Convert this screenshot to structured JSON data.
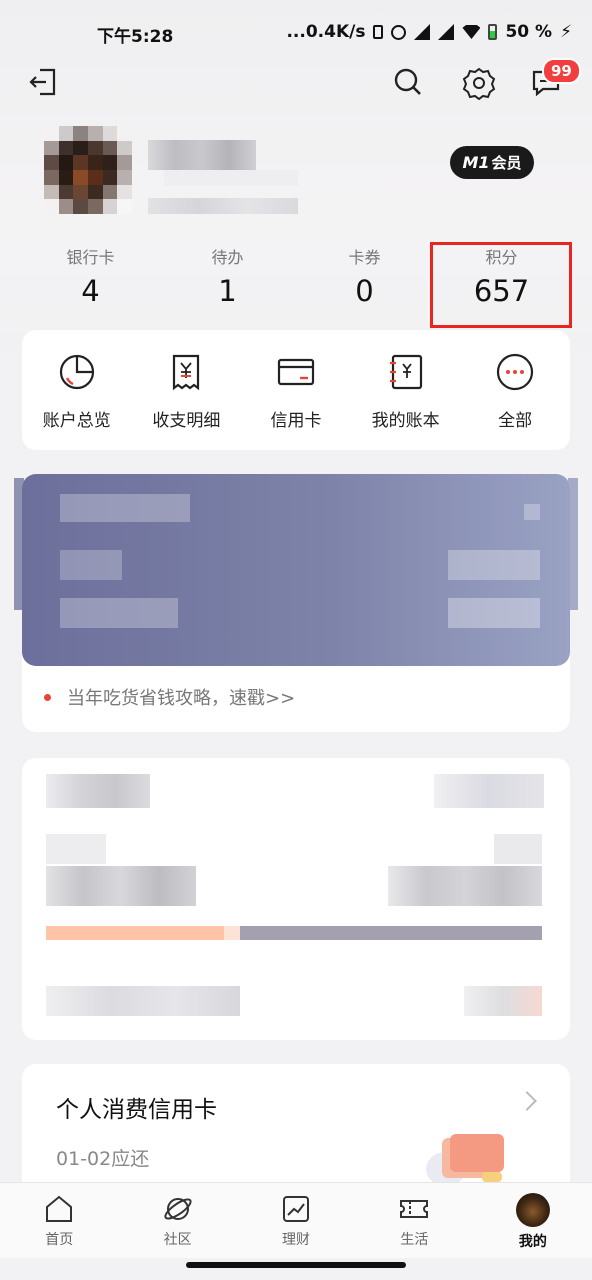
{
  "status_bar": {
    "time": "下午5:28",
    "net_speed": "...0.4K/s",
    "battery": "50 %"
  },
  "header": {
    "messages_badge": "99"
  },
  "profile": {
    "member_label": "会员",
    "member_brand": "M1"
  },
  "stats": [
    {
      "label": "银行卡",
      "value": "4"
    },
    {
      "label": "待办",
      "value": "1"
    },
    {
      "label": "卡券",
      "value": "0"
    },
    {
      "label": "积分",
      "value": "657"
    }
  ],
  "quick_menu": [
    {
      "label": "账户总览",
      "icon": "pie-chart-icon"
    },
    {
      "label": "收支明细",
      "icon": "receipt-icon"
    },
    {
      "label": "信用卡",
      "icon": "credit-card-icon"
    },
    {
      "label": "我的账本",
      "icon": "ledger-icon"
    },
    {
      "label": "全部",
      "icon": "more-icon"
    }
  ],
  "promo": {
    "text": "当年吃货省钱攻略，速戳>>"
  },
  "credit_card": {
    "title": "个人消费信用卡",
    "due": "01-02应还"
  },
  "tabs": [
    {
      "label": "首页",
      "icon": "home-icon"
    },
    {
      "label": "社区",
      "icon": "planet-icon"
    },
    {
      "label": "理财",
      "icon": "chart-icon"
    },
    {
      "label": "生活",
      "icon": "ticket-icon"
    },
    {
      "label": "我的",
      "icon": "avatar-icon"
    }
  ],
  "colors": {
    "accent": "#e8251f",
    "badge": "#f23e3e",
    "banner": "#7d83a8"
  }
}
